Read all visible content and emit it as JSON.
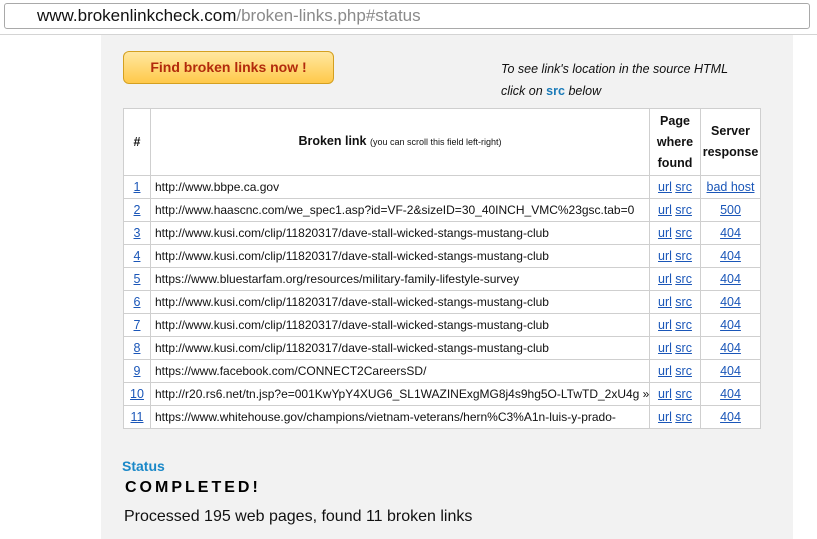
{
  "browser": {
    "url_host": "www.brokenlinkcheck.com",
    "url_path": "/broken-links.php#status"
  },
  "find_button": {
    "label": "Find broken links now !"
  },
  "note": {
    "line1": "To see link's location in the source HTML",
    "line2_prefix": "click on",
    "line2_src": "src",
    "line2_suffix": "below"
  },
  "table": {
    "headers": {
      "num": "#",
      "link": "Broken link",
      "link_hint": "(you can scroll this field left-right)",
      "page_line1": "Page",
      "page_line2": "where",
      "page_line3": "found",
      "server_line1": "Server",
      "server_line2": "response"
    },
    "rows": [
      {
        "num": "1",
        "link": "http://www.bbpe.ca.gov",
        "url": "url",
        "src": "src",
        "response": "bad host"
      },
      {
        "num": "2",
        "link": "http://www.haascnc.com/we_spec1.asp?id=VF-2&sizeID=30_40INCH_VMC%23gsc.tab=0",
        "url": "url",
        "src": "src",
        "response": "500"
      },
      {
        "num": "3",
        "link": "http://www.kusi.com/clip/11820317/dave-stall-wicked-stangs-mustang-club",
        "url": "url",
        "src": "src",
        "response": "404"
      },
      {
        "num": "4",
        "link": "http://www.kusi.com/clip/11820317/dave-stall-wicked-stangs-mustang-club",
        "url": "url",
        "src": "src",
        "response": "404"
      },
      {
        "num": "5",
        "link": "https://www.bluestarfam.org/resources/military-family-lifestyle-survey",
        "url": "url",
        "src": "src",
        "response": "404"
      },
      {
        "num": "6",
        "link": "http://www.kusi.com/clip/11820317/dave-stall-wicked-stangs-mustang-club",
        "url": "url",
        "src": "src",
        "response": "404"
      },
      {
        "num": "7",
        "link": "http://www.kusi.com/clip/11820317/dave-stall-wicked-stangs-mustang-club",
        "url": "url",
        "src": "src",
        "response": "404"
      },
      {
        "num": "8",
        "link": "http://www.kusi.com/clip/11820317/dave-stall-wicked-stangs-mustang-club",
        "url": "url",
        "src": "src",
        "response": "404"
      },
      {
        "num": "9",
        "link": "https://www.facebook.com/CONNECT2CareersSD/",
        "url": "url",
        "src": "src",
        "response": "404"
      },
      {
        "num": "10",
        "link": "http://r20.rs6.net/tn.jsp?e=001KwYpY4XUG6_SL1WAZINExgMG8j4s9hg5O-LTwTD_2xU4g »",
        "url": "url",
        "src": "src",
        "response": "404"
      },
      {
        "num": "11",
        "link": "https://www.whitehouse.gov/champions/vietnam-veterans/hern%C3%A1n-luis-y-prado-",
        "url": "url",
        "src": "src",
        "response": "404"
      }
    ]
  },
  "status": {
    "label": "Status",
    "state": "COMPLETED!",
    "summary": "Processed 195 web pages, found 11 broken links"
  },
  "colors": {
    "button_text": "#b22a0c",
    "link": "#1a56b8",
    "status_label": "#1a88c8",
    "content_bg": "#f2f2f2"
  }
}
